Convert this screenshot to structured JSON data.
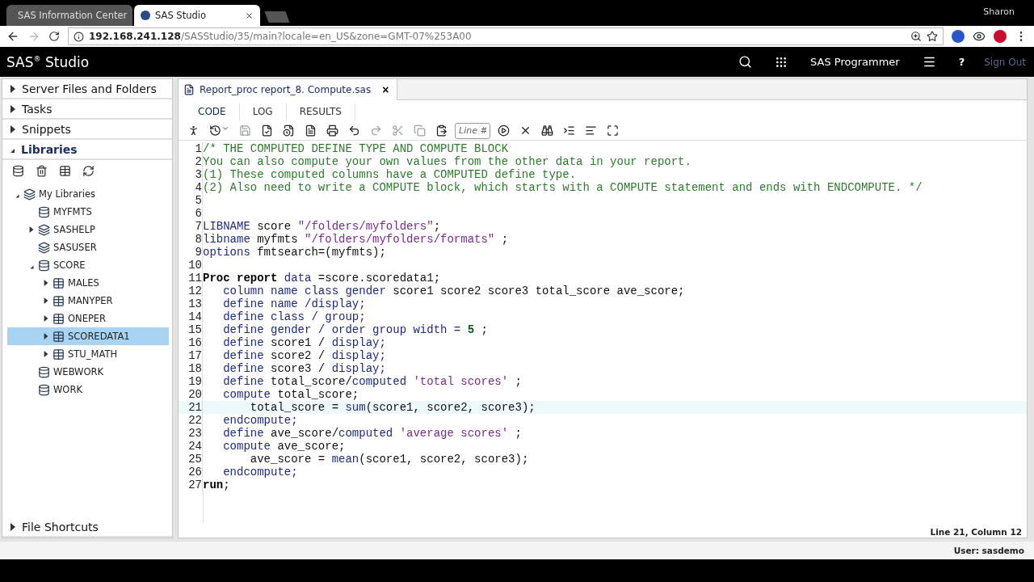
{
  "browser": {
    "tabs": [
      {
        "title": "SAS Information Center",
        "selected": false
      },
      {
        "title": "SAS Studio",
        "selected": true
      }
    ],
    "profile": "Sharon",
    "address": {
      "host": "192.168.241.128",
      "path": "/SASStudio/35/main?locale=en_US&zone=GMT-07%253A00"
    }
  },
  "header": {
    "title": "SAS$^{®}$ Studio",
    "perspective": "SAS Programmer",
    "sign_out": "Sign Out",
    "help": "?"
  },
  "sidebar": {
    "sections": [
      {
        "label": "Server Files and Folders",
        "expanded": false
      },
      {
        "label": "Tasks",
        "expanded": false
      },
      {
        "label": "Snippets",
        "expanded": false
      },
      {
        "label": "Libraries",
        "expanded": true
      },
      {
        "label": "File Shortcuts",
        "expanded": false
      }
    ],
    "tree": [
      {
        "label": "My Libraries",
        "kind": "libraries",
        "expanded": true,
        "selected": false,
        "children": [
          {
            "label": "MYFMTS",
            "kind": "library",
            "selected": false
          },
          {
            "label": "SASHELP",
            "kind": "libraries",
            "expanded": false,
            "selected": false
          },
          {
            "label": "SASUSER",
            "kind": "libraries",
            "selected": false
          },
          {
            "label": "SCORE",
            "kind": "library",
            "expanded": true,
            "selected": false,
            "children": [
              {
                "label": "MALES",
                "kind": "table",
                "expanded": false,
                "selected": false
              },
              {
                "label": "MANYPER",
                "kind": "table",
                "expanded": false,
                "selected": false
              },
              {
                "label": "ONEPER",
                "kind": "table",
                "expanded": false,
                "selected": false
              },
              {
                "label": "SCOREDATA1",
                "kind": "table",
                "expanded": false,
                "selected": true
              },
              {
                "label": "STU_MATH",
                "kind": "table",
                "expanded": false,
                "selected": false
              }
            ]
          },
          {
            "label": "WEBWORK",
            "kind": "library",
            "selected": false
          },
          {
            "label": "WORK",
            "kind": "library",
            "selected": false
          }
        ]
      }
    ]
  },
  "editor": {
    "file_tab": "Report_proc report_8. Compute.sas",
    "close": "×",
    "tabs": [
      {
        "label": "CODE",
        "selected": true
      },
      {
        "label": "LOG",
        "selected": false
      },
      {
        "label": "RESULTS",
        "selected": false
      }
    ],
    "toolbar": [
      {
        "disabled": false
      },
      {
        "disabled": false
      },
      {
        "disabled": true
      },
      {
        "disabled": false
      },
      {
        "disabled": false
      },
      {
        "disabled": false
      },
      {
        "disabled": false
      },
      {
        "disabled": false
      },
      {
        "disabled": true
      },
      {
        "disabled": true
      },
      {
        "disabled": true
      },
      {
        "disabled": false
      }
    ],
    "line_field": {
      "placeholder": "Line #"
    },
    "toolbar_end": [
      {
        "disabled": false
      },
      {
        "disabled": false
      },
      {
        "disabled": false
      },
      {
        "disabled": false
      },
      {
        "disabled": false
      },
      {
        "disabled": false
      }
    ],
    "lines": [
      {
        "number": "1",
        "current": false,
        "tokens": [
          {
            "kind": "comment",
            "text": "/* THE COMPUTED DEFINE TYPE AND COMPUTE BLOCK"
          }
        ]
      },
      {
        "number": "2",
        "current": false,
        "tokens": [
          {
            "kind": "comment",
            "text": "You can also compute your own values from the other data in your report."
          }
        ]
      },
      {
        "number": "3",
        "current": false,
        "tokens": [
          {
            "kind": "comment",
            "text": "(1) These computed columns have a COMPUTED define type."
          }
        ]
      },
      {
        "number": "4",
        "current": false,
        "tokens": [
          {
            "kind": "comment",
            "text": "(2) Also need to write a COMPUTE block, which starts with a COMPUTE statement and ends with ENDCOMPUTE. */"
          }
        ]
      },
      {
        "number": "5",
        "current": false
      },
      {
        "number": "6",
        "current": false
      },
      {
        "number": "7",
        "current": false,
        "tokens": [
          {
            "kind": "keyword",
            "text": "LIBNAME"
          },
          {
            "kind": "plain",
            "text": " score "
          },
          {
            "kind": "string",
            "text": "\"/folders/myfolders\""
          },
          {
            "kind": "plain",
            "text": ";"
          }
        ]
      },
      {
        "number": "8",
        "current": false,
        "tokens": [
          {
            "kind": "keyword",
            "text": "libname"
          },
          {
            "kind": "plain",
            "text": " myfmts "
          },
          {
            "kind": "string",
            "text": "\"/folders/myfolders/formats\""
          },
          {
            "kind": "plain",
            "text": " ;"
          }
        ]
      },
      {
        "number": "9",
        "current": false,
        "tokens": [
          {
            "kind": "keyword",
            "text": "options"
          },
          {
            "kind": "plain",
            "text": " fmtsearch=(myfmts);"
          }
        ]
      },
      {
        "number": "10",
        "current": false
      },
      {
        "number": "11",
        "current": false,
        "tokens": [
          {
            "kind": "bold",
            "text": "Proc report"
          },
          {
            "kind": "keyword",
            "text": " data"
          },
          {
            "kind": "plain",
            "text": " =score.scoredata1;"
          }
        ]
      },
      {
        "number": "12",
        "current": false,
        "tokens": [
          {
            "kind": "keyword",
            "text": "   column name class gender"
          },
          {
            "kind": "plain",
            "text": " score1 score2 score3 total_score ave_score;"
          }
        ]
      },
      {
        "number": "13",
        "current": false,
        "tokens": [
          {
            "kind": "keyword",
            "text": "   define name /display;"
          }
        ]
      },
      {
        "number": "14",
        "current": false,
        "tokens": [
          {
            "kind": "keyword",
            "text": "   define class / group;"
          }
        ]
      },
      {
        "number": "15",
        "current": false,
        "tokens": [
          {
            "kind": "keyword",
            "text": "   define gender / order group width = "
          },
          {
            "kind": "number",
            "text": "5"
          },
          {
            "kind": "plain",
            "text": " ;"
          }
        ]
      },
      {
        "number": "16",
        "current": false,
        "tokens": [
          {
            "kind": "keyword",
            "text": "   define"
          },
          {
            "kind": "plain",
            "text": " score1 / "
          },
          {
            "kind": "keyword",
            "text": "display;"
          }
        ]
      },
      {
        "number": "17",
        "current": false,
        "tokens": [
          {
            "kind": "keyword",
            "text": "   define"
          },
          {
            "kind": "plain",
            "text": " score2 / "
          },
          {
            "kind": "keyword",
            "text": "display;"
          }
        ]
      },
      {
        "number": "18",
        "current": false,
        "tokens": [
          {
            "kind": "keyword",
            "text": "   define"
          },
          {
            "kind": "plain",
            "text": " score3 / "
          },
          {
            "kind": "keyword",
            "text": "display;"
          }
        ]
      },
      {
        "number": "19",
        "current": false,
        "tokens": [
          {
            "kind": "keyword",
            "text": "   define"
          },
          {
            "kind": "plain",
            "text": " total_score/"
          },
          {
            "kind": "keyword",
            "text": "computed"
          },
          {
            "kind": "string",
            "text": " 'total scores'"
          },
          {
            "kind": "plain",
            "text": " ;"
          }
        ]
      },
      {
        "number": "20",
        "current": false,
        "tokens": [
          {
            "kind": "keyword",
            "text": "   compute"
          },
          {
            "kind": "plain",
            "text": " total_score;"
          }
        ]
      },
      {
        "number": "21",
        "current": true,
        "tokens": [
          {
            "kind": "plain",
            "text": "       total_score = "
          },
          {
            "kind": "keyword",
            "text": "sum"
          },
          {
            "kind": "plain",
            "text": "(score1, score2, score3);"
          }
        ]
      },
      {
        "number": "22",
        "current": false,
        "tokens": [
          {
            "kind": "keyword",
            "text": "   endcompute;"
          }
        ]
      },
      {
        "number": "23",
        "current": false,
        "tokens": [
          {
            "kind": "keyword",
            "text": "   define"
          },
          {
            "kind": "plain",
            "text": " ave_score/"
          },
          {
            "kind": "keyword",
            "text": "computed"
          },
          {
            "kind": "string",
            "text": " 'average scores'"
          },
          {
            "kind": "plain",
            "text": " ;"
          }
        ]
      },
      {
        "number": "24",
        "current": false,
        "tokens": [
          {
            "kind": "keyword",
            "text": "   compute"
          },
          {
            "kind": "plain",
            "text": " ave_score;"
          }
        ]
      },
      {
        "number": "25",
        "current": false,
        "tokens": [
          {
            "kind": "plain",
            "text": "       ave_score = "
          },
          {
            "kind": "keyword",
            "text": "mean"
          },
          {
            "kind": "plain",
            "text": "(score1, score2, score3);"
          }
        ]
      },
      {
        "number": "26",
        "current": false,
        "tokens": [
          {
            "kind": "keyword",
            "text": "   endcompute;"
          }
        ]
      },
      {
        "number": "27",
        "current": false,
        "tokens": [
          {
            "kind": "bold",
            "text": "run"
          },
          {
            "kind": "plain",
            "text": ";"
          }
        ]
      }
    ],
    "position": "Line 21, Column 12"
  },
  "status_bar": {
    "user": "User: sasdemo"
  }
}
